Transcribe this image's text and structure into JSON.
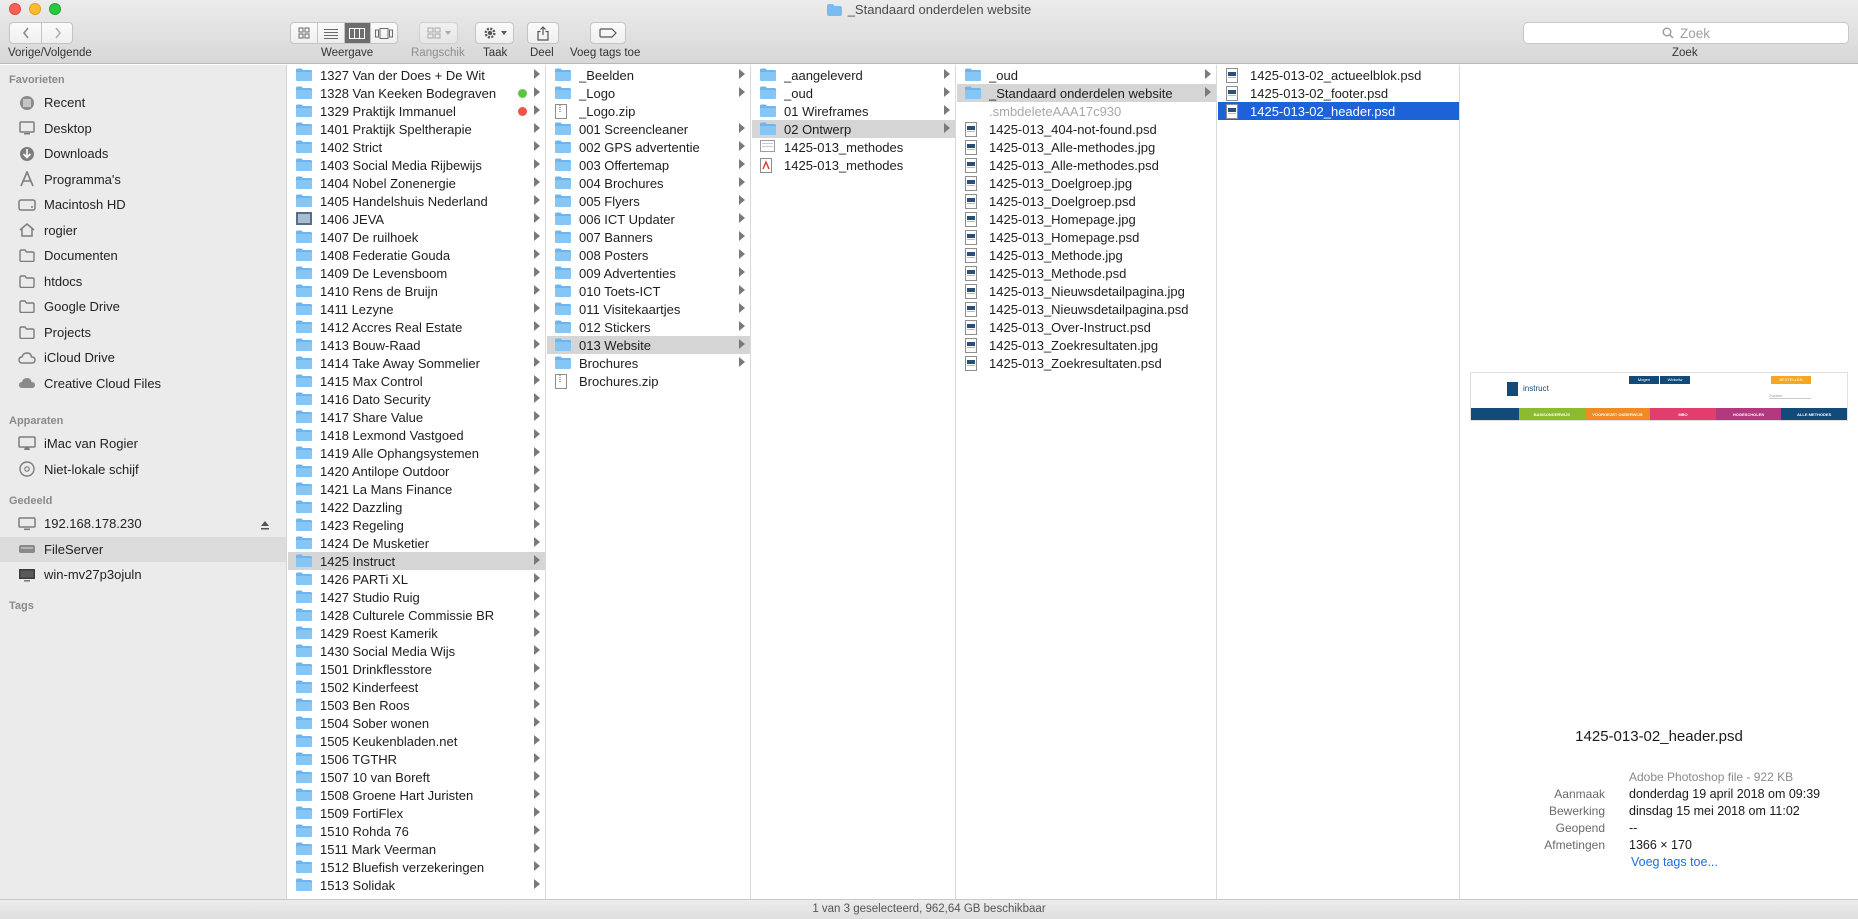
{
  "window": {
    "title": "_Standaard onderdelen website"
  },
  "toolbar": {
    "nav_label": "Vorige/Volgende",
    "view_label": "Weergave",
    "arrange_label": "Rangschik",
    "action_label": "Taak",
    "share_label": "Deel",
    "tags_label": "Voeg tags toe",
    "search_label": "Zoek",
    "search_placeholder": "Zoek"
  },
  "sidebar": {
    "favorites_header": "Favorieten",
    "devices_header": "Apparaten",
    "shared_header": "Gedeeld",
    "tags_header": "Tags",
    "favorites": [
      {
        "label": "Recent",
        "icon": "recent-icon"
      },
      {
        "label": "Desktop",
        "icon": "desktop-folder-icon"
      },
      {
        "label": "Downloads",
        "icon": "downloads-icon"
      },
      {
        "label": "Programma's",
        "icon": "applications-icon"
      },
      {
        "label": "Macintosh HD",
        "icon": "hard-drive-icon"
      },
      {
        "label": "rogier",
        "icon": "home-icon"
      },
      {
        "label": "Documenten",
        "icon": "folder-icon"
      },
      {
        "label": "htdocs",
        "icon": "folder-icon"
      },
      {
        "label": "Google Drive",
        "icon": "folder-icon"
      },
      {
        "label": "Projects",
        "icon": "folder-icon"
      },
      {
        "label": "iCloud Drive",
        "icon": "cloud-icon"
      },
      {
        "label": "Creative Cloud Files",
        "icon": "creative-cloud-icon"
      }
    ],
    "devices": [
      {
        "label": "iMac van Rogier",
        "icon": "imac-icon"
      },
      {
        "label": "Niet-lokale schijf",
        "icon": "disc-icon"
      }
    ],
    "shared": [
      {
        "label": "192.168.178.230",
        "icon": "monitor-icon"
      },
      {
        "label": "FileServer",
        "icon": "server-icon"
      },
      {
        "label": "win-mv27p3ojuln",
        "icon": "pc-icon"
      }
    ]
  },
  "columns": {
    "col1": [
      {
        "label": "1327 Van der Does + De Wit"
      },
      {
        "label": "1328 Van Keeken Bodegraven",
        "tag": "#5cc544"
      },
      {
        "label": "1329 Praktijk Immanuel",
        "tag": "#f0524c"
      },
      {
        "label": "1401 Praktijk Speltherapie"
      },
      {
        "label": "1402 Strict"
      },
      {
        "label": "1403 Social Media Rijbewijs"
      },
      {
        "label": "1404 Nobel Zonenergie"
      },
      {
        "label": "1405 Handelshuis Nederland"
      },
      {
        "label": "1406 JEVA",
        "icon": "image-folder"
      },
      {
        "label": "1407 De ruilhoek"
      },
      {
        "label": "1408 Federatie Gouda"
      },
      {
        "label": "1409 De Levensboom"
      },
      {
        "label": "1410 Rens de Bruijn"
      },
      {
        "label": "1411 Lezyne"
      },
      {
        "label": "1412 Accres Real Estate"
      },
      {
        "label": "1413 Bouw-Raad"
      },
      {
        "label": "1414 Take Away Sommelier"
      },
      {
        "label": "1415 Max Control"
      },
      {
        "label": "1416 Dato Security"
      },
      {
        "label": "1417 Share Value"
      },
      {
        "label": "1418 Lexmond Vastgoed"
      },
      {
        "label": "1419 Alle Ophangsystemen"
      },
      {
        "label": "1420 Antilope Outdoor"
      },
      {
        "label": "1421 La Mans Finance"
      },
      {
        "label": "1422 Dazzling"
      },
      {
        "label": "1423 Regeling"
      },
      {
        "label": "1424 De Musketier"
      },
      {
        "label": "1425 Instruct",
        "state": "grey"
      },
      {
        "label": "1426 PARTi XL"
      },
      {
        "label": "1427 Studio Ruig"
      },
      {
        "label": "1428 Culturele Commissie BR"
      },
      {
        "label": "1429 Roest Kamerik"
      },
      {
        "label": "1430 Social Media Wijs"
      },
      {
        "label": "1501 Drinkflesstore"
      },
      {
        "label": "1502 Kinderfeest"
      },
      {
        "label": "1503 Ben Roos"
      },
      {
        "label": "1504 Sober wonen"
      },
      {
        "label": "1505 Keukenbladen.net"
      },
      {
        "label": "1506 TGTHR"
      },
      {
        "label": "1507 10 van Boreft"
      },
      {
        "label": "1508 Groene Hart Juristen"
      },
      {
        "label": "1509 FortiFlex"
      },
      {
        "label": "1510 Rohda 76"
      },
      {
        "label": "1511 Mark Veerman"
      },
      {
        "label": "1512 Bluefish verzekeringen"
      },
      {
        "label": "1513 Solidak"
      }
    ],
    "col2": [
      {
        "label": "_Beelden",
        "type": "folder"
      },
      {
        "label": "_Logo",
        "type": "folder"
      },
      {
        "label": "_Logo.zip",
        "type": "zip"
      },
      {
        "label": "001 Screencleaner",
        "type": "folder"
      },
      {
        "label": "002 GPS advertentie",
        "type": "folder"
      },
      {
        "label": "003 Offertemap",
        "type": "folder"
      },
      {
        "label": "004 Brochures",
        "type": "folder"
      },
      {
        "label": "005 Flyers",
        "type": "folder"
      },
      {
        "label": "006 ICT Updater",
        "type": "folder"
      },
      {
        "label": "007 Banners",
        "type": "folder"
      },
      {
        "label": "008 Posters",
        "type": "folder"
      },
      {
        "label": "009 Advertenties",
        "type": "folder"
      },
      {
        "label": "010 Toets-ICT",
        "type": "folder"
      },
      {
        "label": "011 Visitekaartjes",
        "type": "folder"
      },
      {
        "label": "012 Stickers",
        "type": "folder"
      },
      {
        "label": "013 Website",
        "type": "folder",
        "state": "grey"
      },
      {
        "label": "Brochures",
        "type": "folder"
      },
      {
        "label": "Brochures.zip",
        "type": "zip"
      }
    ],
    "col3": [
      {
        "label": "_aangeleverd",
        "type": "folder"
      },
      {
        "label": "_oud",
        "type": "folder"
      },
      {
        "label": "01 Wireframes",
        "type": "folder"
      },
      {
        "label": "02 Ontwerp",
        "type": "folder",
        "state": "grey"
      },
      {
        "label": "1425-013_methodes",
        "type": "doc"
      },
      {
        "label": "1425-013_methodes",
        "type": "pdf"
      }
    ],
    "col4": [
      {
        "label": "_oud",
        "type": "folder"
      },
      {
        "label": "_Standaard onderdelen website",
        "type": "folder",
        "state": "grey"
      },
      {
        "label": ".smbdeleteAAA17c930",
        "type": "none",
        "state": "dim"
      },
      {
        "label": "1425-013_404-not-found.psd",
        "type": "psd"
      },
      {
        "label": "1425-013_Alle-methodes.jpg",
        "type": "psd"
      },
      {
        "label": "1425-013_Alle-methodes.psd",
        "type": "psd"
      },
      {
        "label": "1425-013_Doelgroep.jpg",
        "type": "psd"
      },
      {
        "label": "1425-013_Doelgroep.psd",
        "type": "psd"
      },
      {
        "label": "1425-013_Homepage.jpg",
        "type": "psd"
      },
      {
        "label": "1425-013_Homepage.psd",
        "type": "psd"
      },
      {
        "label": "1425-013_Methode.jpg",
        "type": "psd"
      },
      {
        "label": "1425-013_Methode.psd",
        "type": "psd"
      },
      {
        "label": "1425-013_Nieuwsdetailpagina.jpg",
        "type": "psd"
      },
      {
        "label": "1425-013_Nieuwsdetailpagina.psd",
        "type": "psd"
      },
      {
        "label": "1425-013_Over-Instruct.psd",
        "type": "psd"
      },
      {
        "label": "1425-013_Zoekresultaten.jpg",
        "type": "psd"
      },
      {
        "label": "1425-013_Zoekresultaten.psd",
        "type": "psd"
      }
    ],
    "col5": [
      {
        "label": "1425-013-02_actueelblok.psd",
        "type": "psd"
      },
      {
        "label": "1425-013-02_footer.psd",
        "type": "psd"
      },
      {
        "label": "1425-013-02_header.psd",
        "type": "psd",
        "state": "blue"
      }
    ]
  },
  "preview": {
    "filename": "1425-013-02_header.psd",
    "kind": "Adobe Photoshop file - 922 KB",
    "created_label": "Aanmaak",
    "created_value": "donderdag 19 april 2018 om 09:39",
    "modified_label": "Bewerking",
    "modified_value": "dinsdag 15 mei 2018 om 11:02",
    "opened_label": "Geopend",
    "opened_value": "--",
    "dimensions_label": "Afmetingen",
    "dimensions_value": "1366 × 170",
    "add_tags_link": "Voeg tags toe...",
    "thumb": {
      "brand": "instruct",
      "top_links": [
        "Mogen",
        "Winkelw"
      ],
      "top_button": "BESTELLEN",
      "search": "Zoeken",
      "nav": [
        {
          "label": "BASISONDERWIJS",
          "color": "#8dbb2f"
        },
        {
          "label": "VOORGEZET ONDERWIJS",
          "color": "#f08a24"
        },
        {
          "label": "MBO",
          "color": "#e23d6c"
        },
        {
          "label": "HOGESCHOLEN",
          "color": "#b2387f"
        },
        {
          "label": "ALLE METHODES",
          "color": "#124a7a"
        }
      ]
    }
  },
  "status": {
    "text": "1 van 3 geselecteerd, 962,64 GB beschikbaar"
  },
  "colors": {
    "selection": "#1d63d7",
    "folder": "#78bcf0",
    "tag_green": "#5cc544",
    "tag_red": "#f0524c"
  }
}
